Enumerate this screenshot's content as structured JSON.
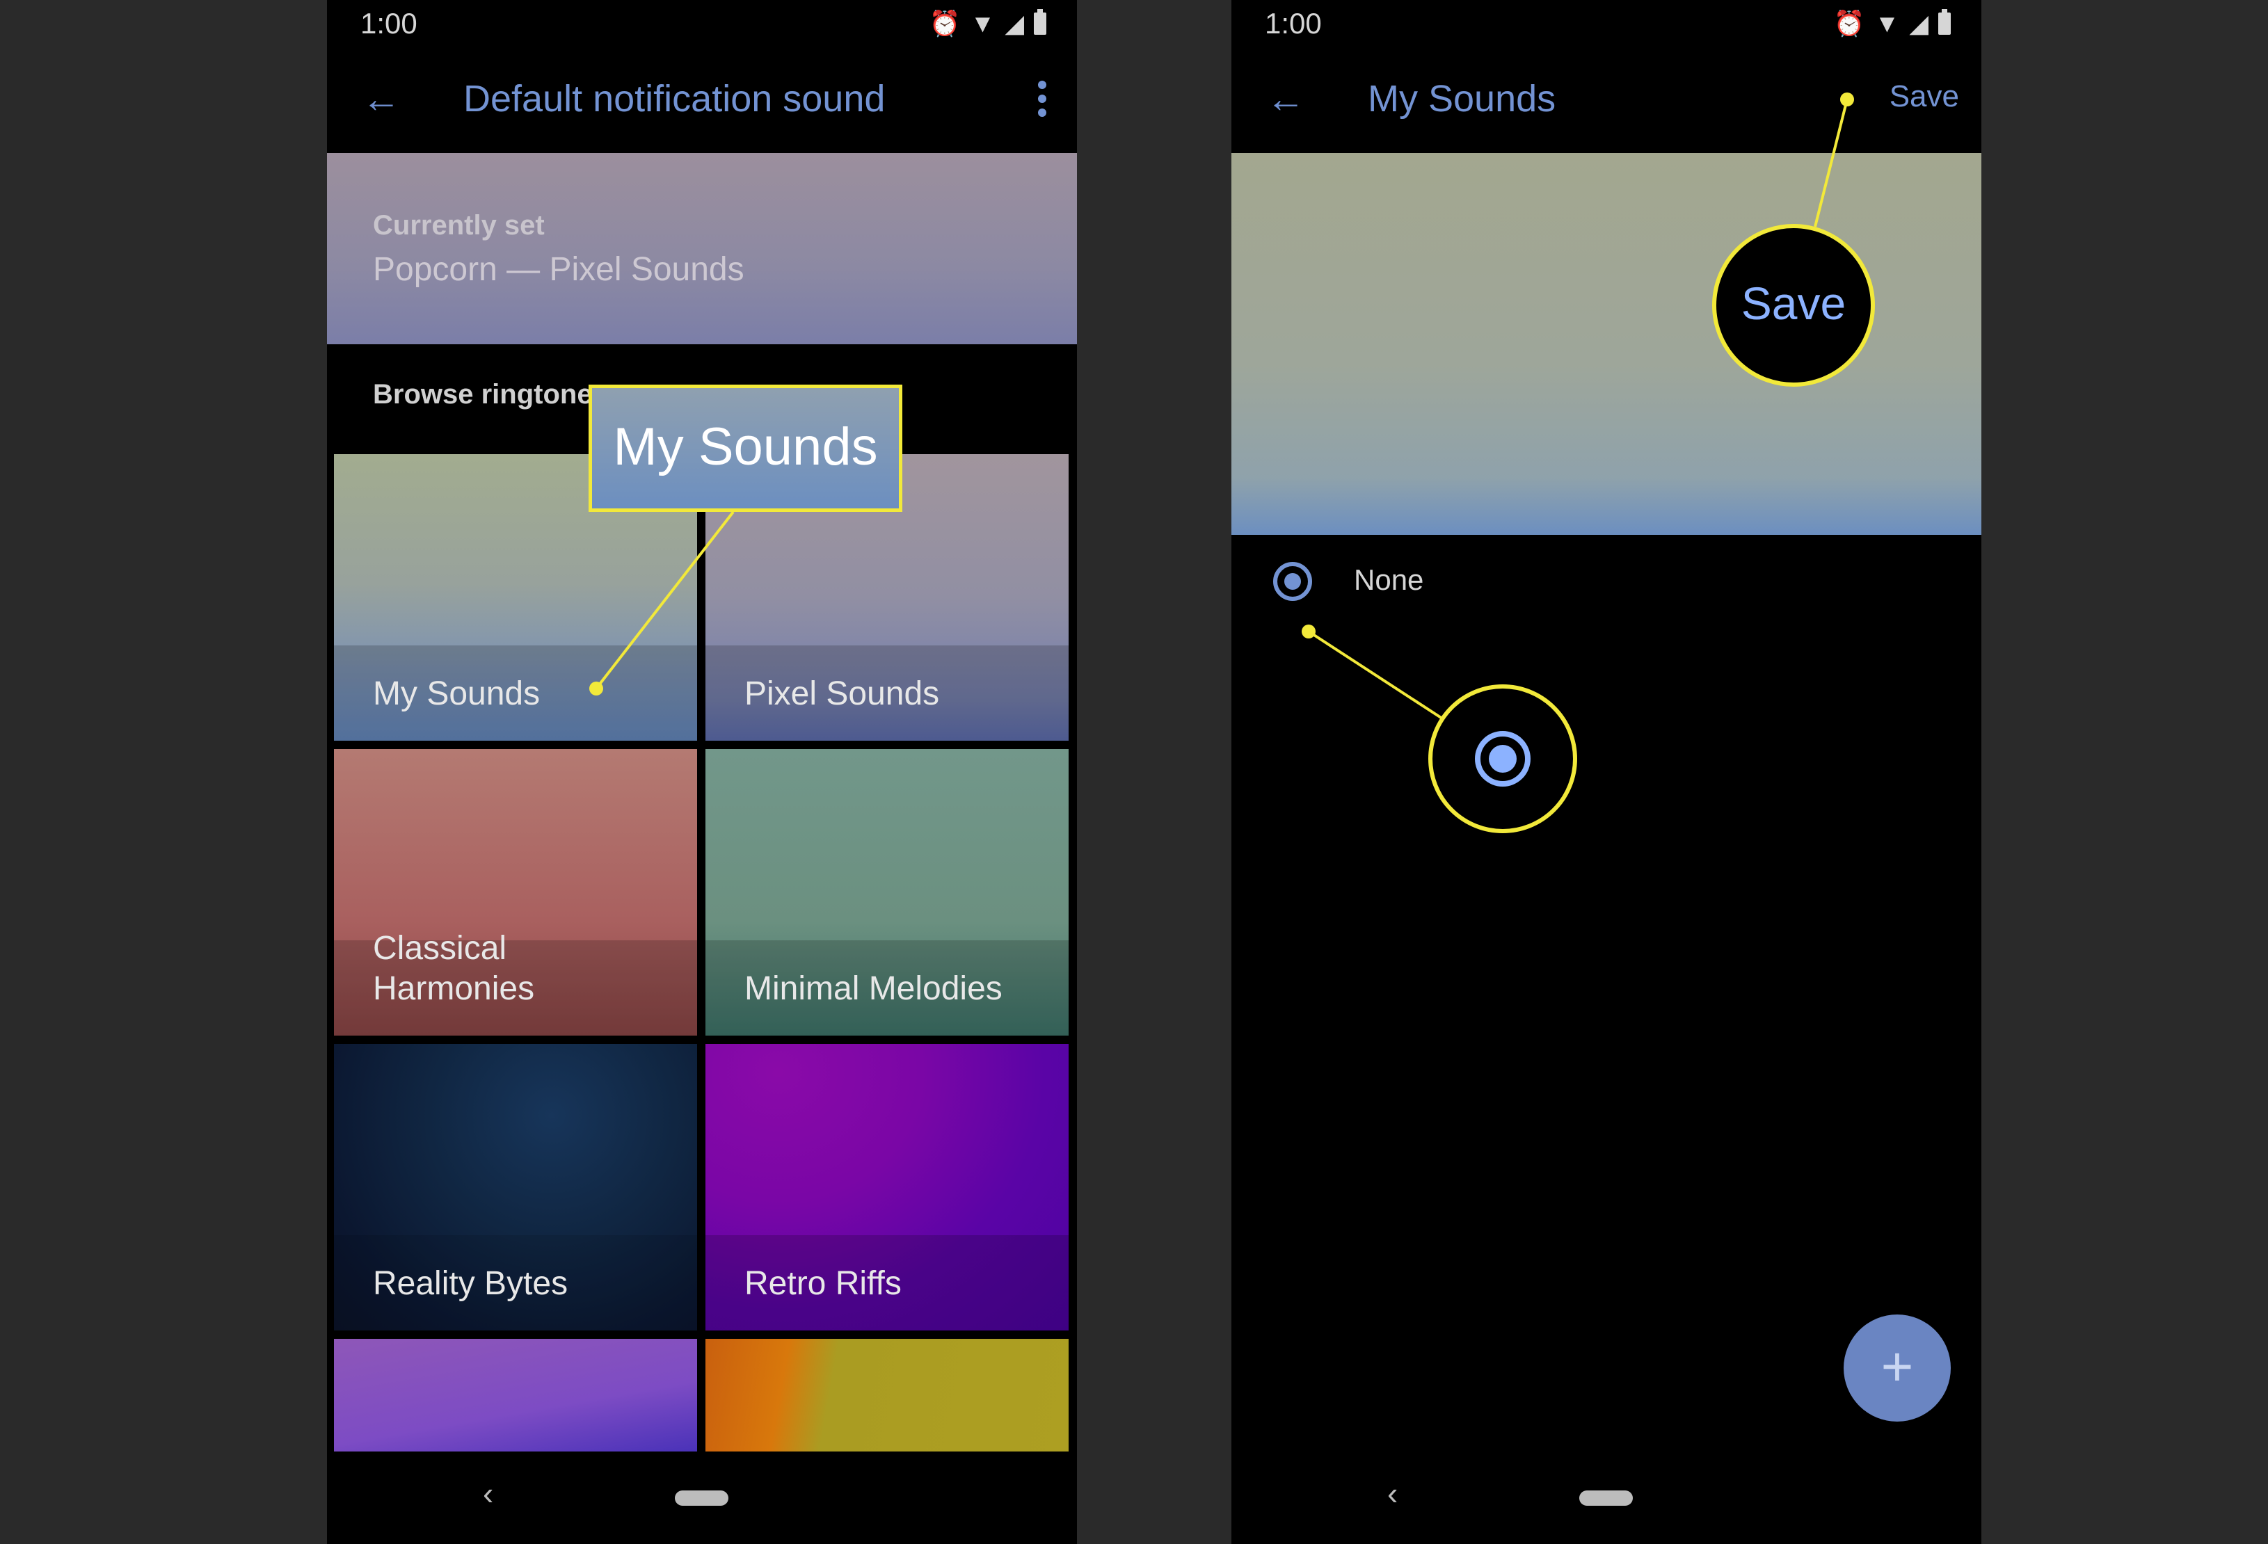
{
  "left_phone": {
    "status": {
      "time": "1:00",
      "icons": [
        "alarm-icon",
        "wifi-icon",
        "signal-icon",
        "battery-icon"
      ]
    },
    "toolbar": {
      "back_icon": "arrow-left-icon",
      "title": "Default notification sound",
      "menu_icon": "more-vert-icon"
    },
    "current": {
      "label": "Currently set",
      "value": "Popcorn — Pixel Sounds"
    },
    "browse_label": "Browse ringtones",
    "tiles": [
      {
        "name": "My Sounds"
      },
      {
        "name": "Pixel Sounds"
      },
      {
        "name": "Classical Harmonies"
      },
      {
        "name": "Minimal Melodies"
      },
      {
        "name": "Reality Bytes"
      },
      {
        "name": "Retro Riffs"
      },
      {
        "name": ""
      },
      {
        "name": ""
      }
    ]
  },
  "right_phone": {
    "status": {
      "time": "1:00"
    },
    "toolbar": {
      "title": "My Sounds",
      "save": "Save"
    },
    "options": [
      {
        "label": "None",
        "selected": true
      }
    ],
    "fab_icon": "plus-icon",
    "fab_label": "+"
  },
  "callouts": {
    "my_sounds": "My Sounds",
    "save": "Save",
    "color": "#f2e93a"
  },
  "accent": "#7393d3"
}
